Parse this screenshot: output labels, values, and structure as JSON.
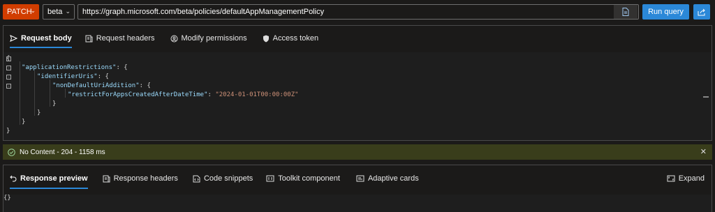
{
  "topbar": {
    "method": "PATCH",
    "version": "beta",
    "url": "https://graph.microsoft.com/beta/policies/defaultAppManagementPolicy",
    "run_label": "Run query",
    "icons": [
      "chevron-down-icon",
      "document-icon",
      "share-icon"
    ]
  },
  "request": {
    "tabs": [
      {
        "label": "Request body",
        "icon": "send-icon",
        "active": true
      },
      {
        "label": "Request headers",
        "icon": "headers-icon",
        "active": false
      },
      {
        "label": "Modify permissions",
        "icon": "permissions-icon",
        "active": false
      },
      {
        "label": "Access token",
        "icon": "lock-icon",
        "active": false
      }
    ],
    "body_lines": [
      {
        "indent": 0,
        "text": "{"
      },
      {
        "indent": 1,
        "key": "\"applicationRestrictions\"",
        "rest": ": {"
      },
      {
        "indent": 2,
        "key": "\"identifierUris\"",
        "rest": ": {"
      },
      {
        "indent": 3,
        "key": "\"nonDefaultUriAddition\"",
        "rest": ": {"
      },
      {
        "indent": 4,
        "key": "\"restrictForAppsCreatedAfterDateTime\"",
        "sep": ": ",
        "value": "\"2024-01-01T00:00:00Z\""
      },
      {
        "indent": 3,
        "text": "}"
      },
      {
        "indent": 2,
        "text": "}"
      },
      {
        "indent": 1,
        "text": "}"
      },
      {
        "indent": 0,
        "text": "}"
      }
    ]
  },
  "status": {
    "text": "No Content - 204 - 1158 ms",
    "color": "#393d1b"
  },
  "response": {
    "tabs": [
      {
        "label": "Response preview",
        "icon": "undo-icon",
        "active": true
      },
      {
        "label": "Response headers",
        "icon": "headers-icon",
        "active": false
      },
      {
        "label": "Code snippets",
        "icon": "code-icon",
        "active": false
      },
      {
        "label": "Toolkit component",
        "icon": "component-icon",
        "active": false
      },
      {
        "label": "Adaptive cards",
        "icon": "card-icon",
        "active": false
      }
    ],
    "expand_label": "Expand",
    "body": "{}"
  },
  "colors": {
    "accent": "#2b88d8",
    "method": "#d13d00",
    "key": "#9cdcfe",
    "string": "#ce9178"
  }
}
